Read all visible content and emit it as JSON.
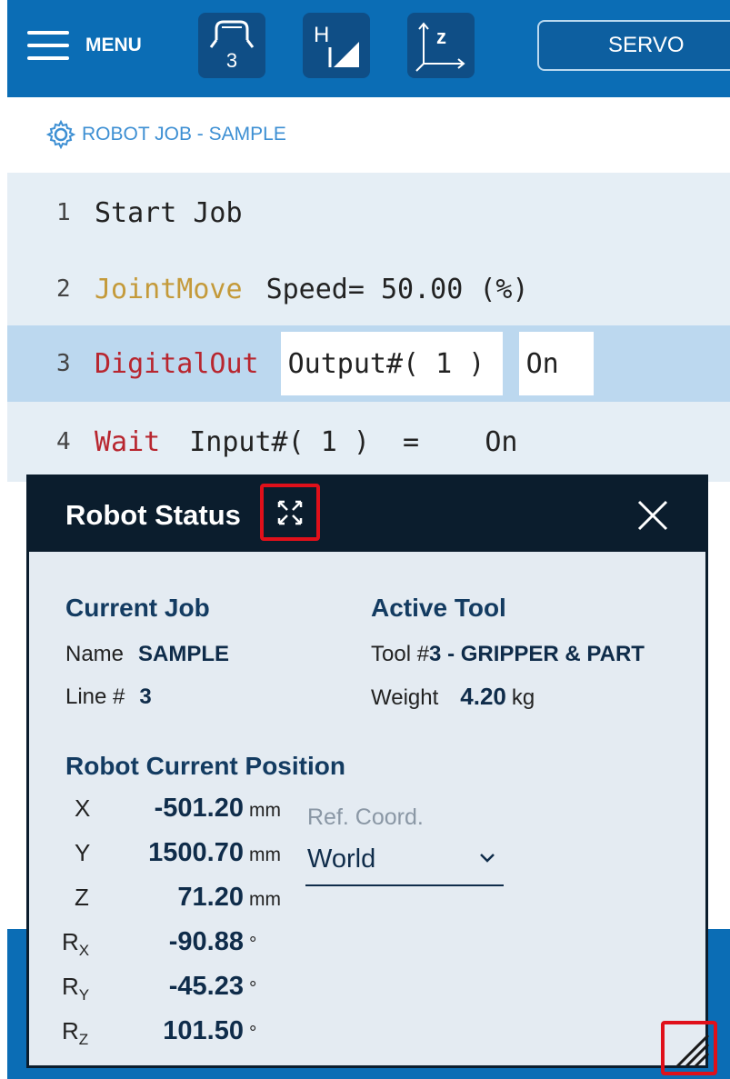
{
  "topbar": {
    "menu_label": "MENU",
    "tool_number": "3",
    "servo_label": "SERVO"
  },
  "breadcrumb": {
    "text": "ROBOT JOB - SAMPLE"
  },
  "job_lines": [
    {
      "num": "1",
      "parts": [
        "Start Job"
      ]
    },
    {
      "num": "2",
      "keyword": "JointMove",
      "param": "Speed= 50.00 (%)"
    },
    {
      "num": "3",
      "keyword": "DigitalOut",
      "field1": "Output#( 1 )",
      "field2": "On"
    },
    {
      "num": "4",
      "keyword": "Wait",
      "param": "Input#( 1 )  =    On"
    }
  ],
  "robot_status": {
    "title": "Robot Status",
    "current_job": {
      "heading": "Current Job",
      "name_label": "Name",
      "name_value": "SAMPLE",
      "line_label": "Line #",
      "line_value": "3"
    },
    "active_tool": {
      "heading": "Active Tool",
      "tool_label": "Tool #",
      "tool_value": "3 - GRIPPER & PART",
      "weight_label": "Weight",
      "weight_value": "4.20",
      "weight_unit": "kg"
    },
    "position": {
      "heading": "Robot Current Position",
      "x": {
        "label": "X",
        "value": "-501.20",
        "unit": "mm"
      },
      "y": {
        "label": "Y",
        "value": "1500.70",
        "unit": "mm"
      },
      "z": {
        "label": "Z",
        "value": "71.20",
        "unit": "mm"
      },
      "rx": {
        "label": "R",
        "sub": "X",
        "value": "-90.88",
        "unit": "°"
      },
      "ry": {
        "label": "R",
        "sub": "Y",
        "value": "-45.23",
        "unit": "°"
      },
      "rz": {
        "label": "R",
        "sub": "Z",
        "value": "101.50",
        "unit": "°"
      }
    },
    "ref_coord": {
      "label": "Ref. Coord.",
      "value": "World"
    }
  },
  "colors": {
    "topbar": "#0b6db5",
    "panel_header": "#0b1d2d",
    "highlight": "#e0101a",
    "keyword_yellow": "#c49a3a",
    "keyword_red": "#b8262f"
  }
}
